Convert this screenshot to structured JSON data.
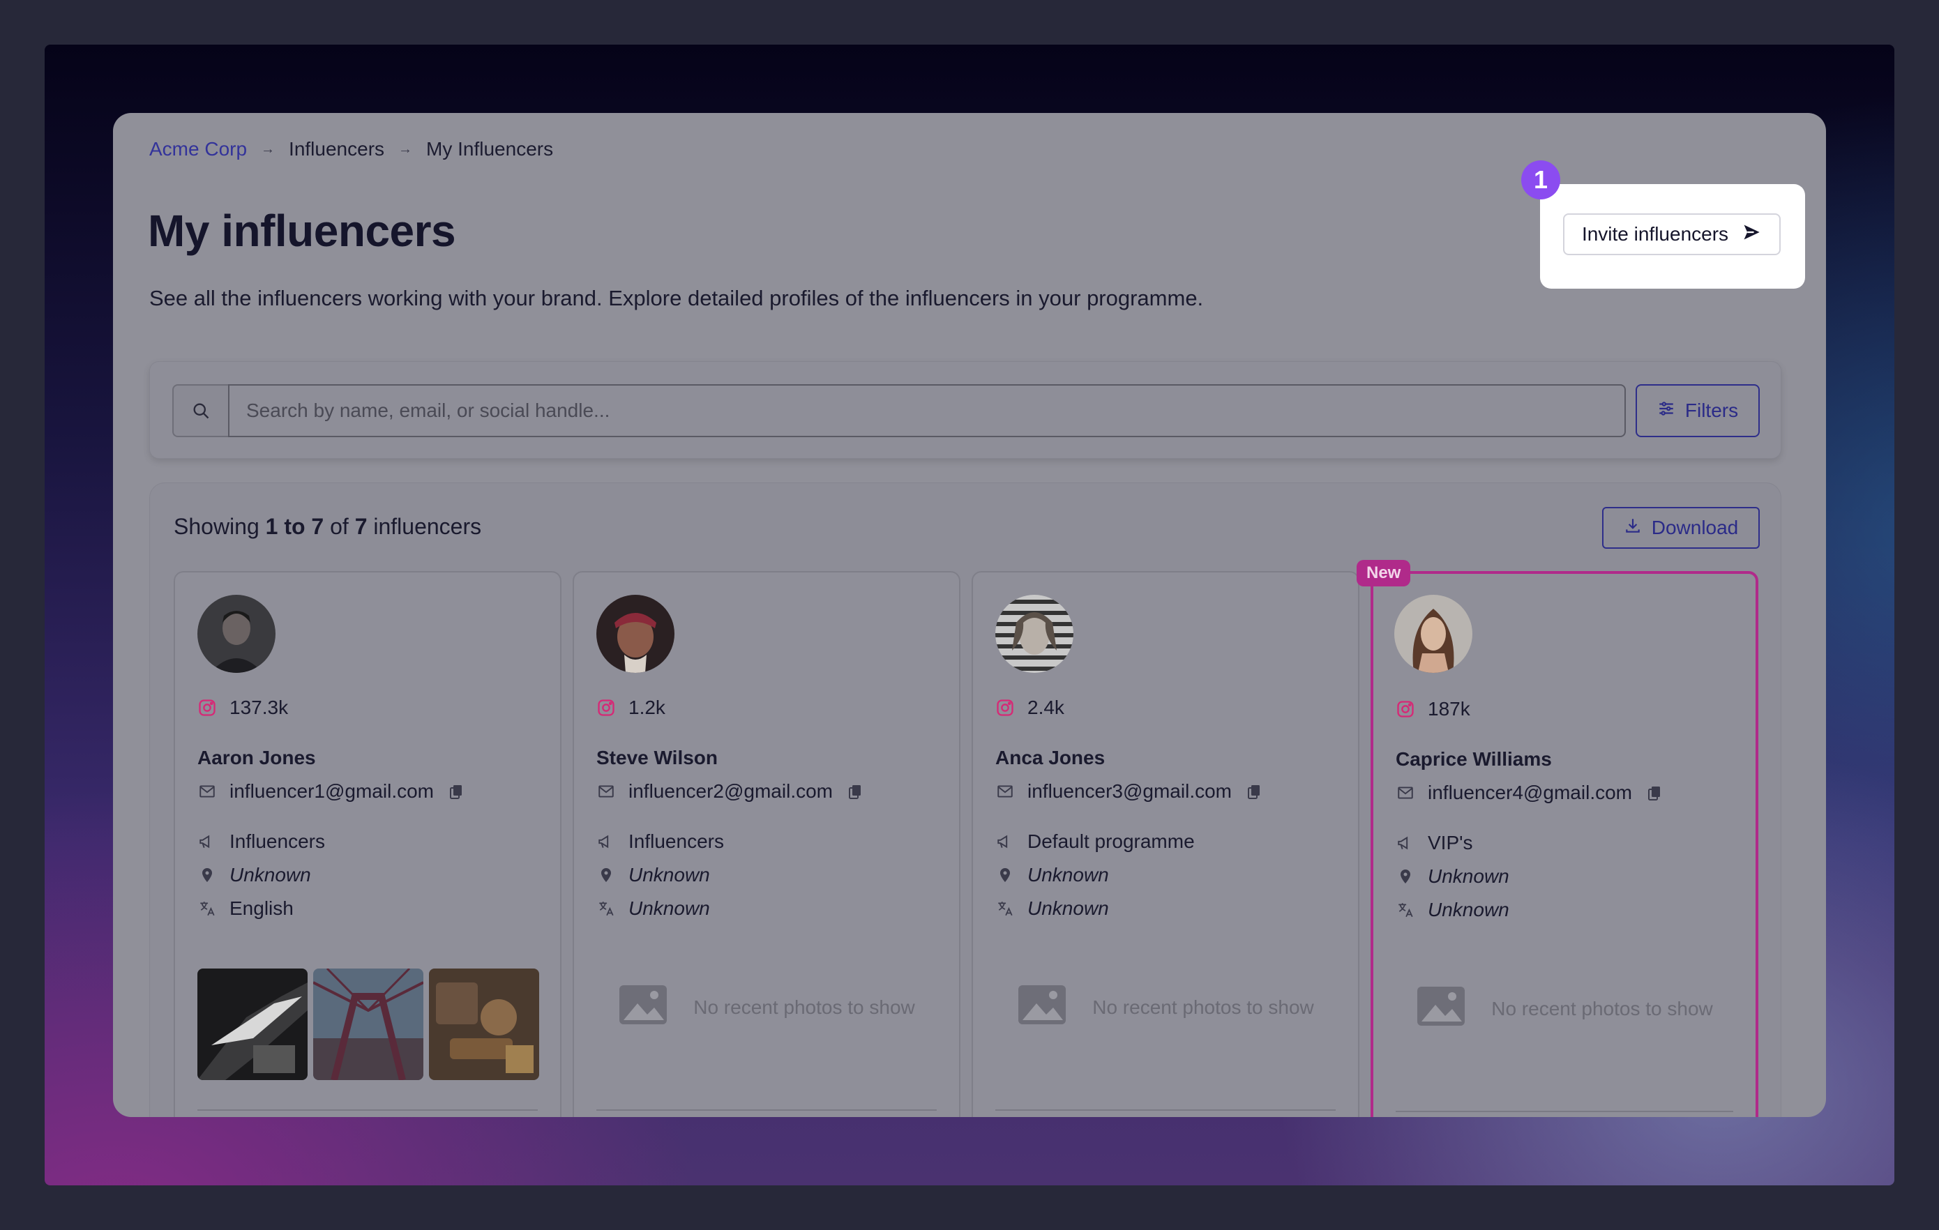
{
  "breadcrumb": {
    "items": [
      "Acme Corp",
      "Influencers",
      "My Influencers"
    ],
    "separator": "→"
  },
  "header": {
    "title": "My influencers",
    "description": "See all the influencers working with your brand. Explore detailed profiles of the influencers in your programme.",
    "invite_label": "Invite influencers",
    "step_number": "1"
  },
  "search": {
    "placeholder": "Search by name, email, or social handle...",
    "value": "",
    "filters_label": "Filters"
  },
  "results": {
    "showing_prefix": "Showing",
    "range": "1 to 7",
    "of_word": "of",
    "total": "7",
    "suffix": "influencers",
    "download_label": "Download"
  },
  "new_badge": "New",
  "no_photos_text": "No recent photos to show",
  "influencers": [
    {
      "followers": "137.3k",
      "name": "Aaron Jones",
      "email": "influencer1@gmail.com",
      "programme": "Influencers",
      "location": "Unknown",
      "language": "English",
      "has_photos": true
    },
    {
      "followers": "1.2k",
      "name": "Steve Wilson",
      "email": "influencer2@gmail.com",
      "programme": "Influencers",
      "location": "Unknown",
      "language": "Unknown",
      "has_photos": false
    },
    {
      "followers": "2.4k",
      "name": "Anca Jones",
      "email": "influencer3@gmail.com",
      "programme": "Default programme",
      "location": "Unknown",
      "language": "Unknown",
      "has_photos": false
    },
    {
      "followers": "187k",
      "name": "Caprice Williams",
      "email": "influencer4@gmail.com",
      "programme": "VIP's",
      "location": "Unknown",
      "language": "Unknown",
      "has_photos": false,
      "is_new": true
    }
  ],
  "colors": {
    "accent": "#2e2e8a",
    "new_badge": "#b02a8a",
    "step_marker": "#8b4cf0",
    "instagram": "#d62976"
  }
}
